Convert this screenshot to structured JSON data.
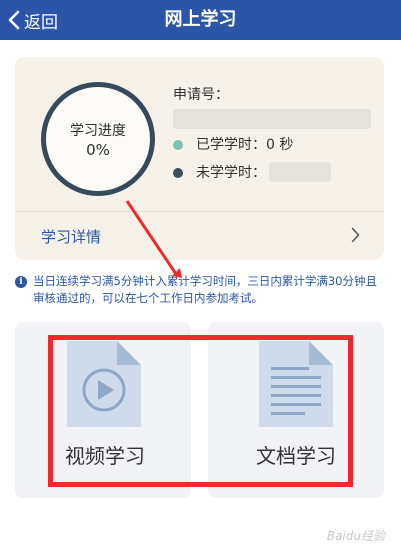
{
  "navbar": {
    "back_label": "返回",
    "title": "网上学习"
  },
  "progress": {
    "label": "学习进度",
    "value": "0%"
  },
  "applicant": {
    "number_label": "申请号：",
    "studied_label": "已学学时：",
    "studied_value": "0 秒",
    "remaining_label": "未学学时："
  },
  "detail": {
    "label": "学习详情"
  },
  "notice": {
    "text": "当日连续学习满5分钟计入累计学习时间，三日内累计学满30分钟且审核通过的，可以在七个工作日内参加考试。"
  },
  "tiles": {
    "video_label": "视频学习",
    "doc_label": "文档学习"
  },
  "watermark": {
    "text": "Baidu经验"
  },
  "colors": {
    "navbar": "#2b56a8",
    "studied_dot": "#7fbfb0",
    "remaining_dot": "#3d4f5f",
    "annotation": "#ec2c2c",
    "icon_fill": "#cfdbea",
    "icon_fold": "#a7bad3",
    "icon_stroke": "#8ea7c7"
  }
}
